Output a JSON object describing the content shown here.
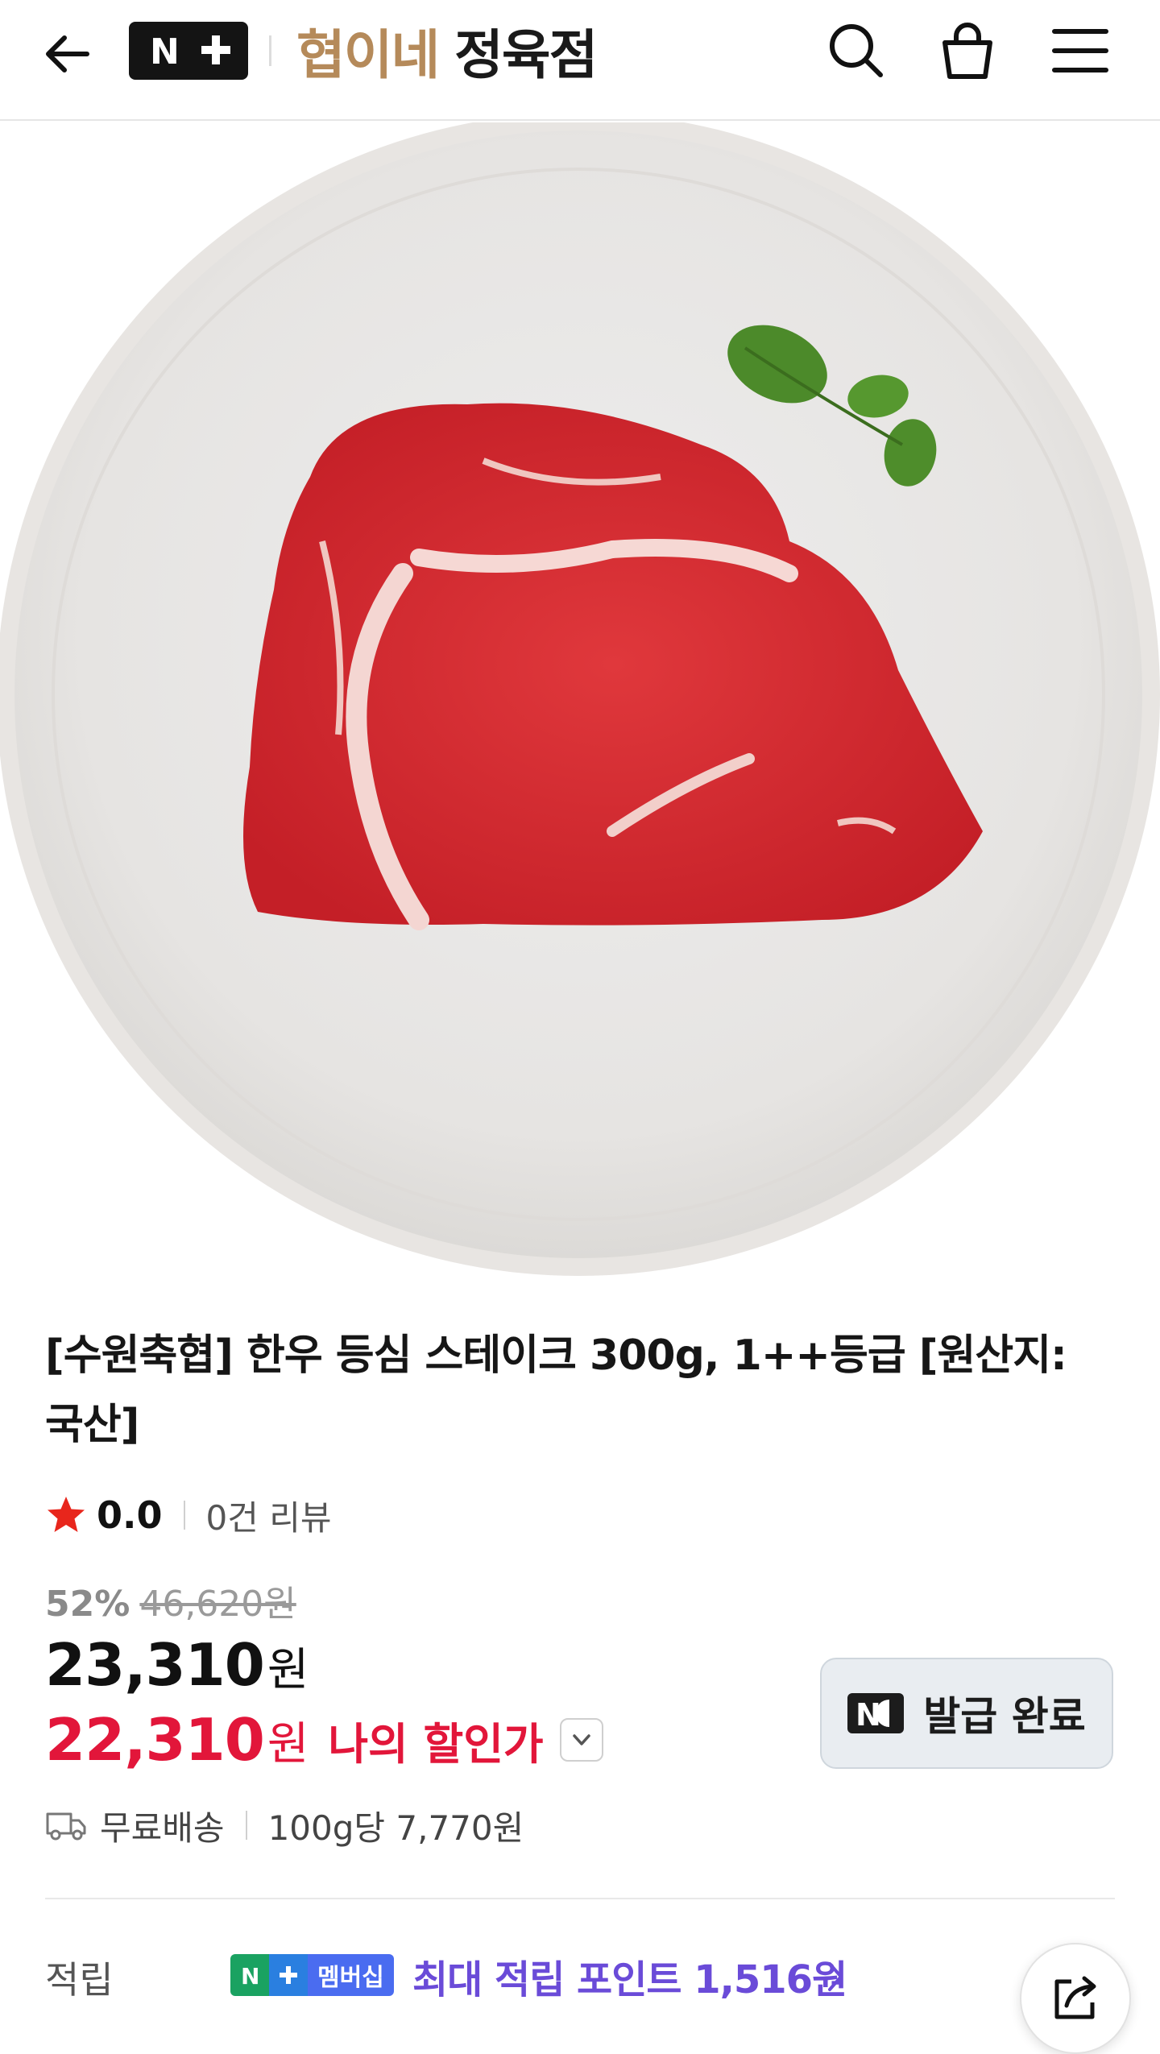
{
  "header": {
    "logo_text": "N+",
    "store_name_part1": "협이네",
    "store_name_part2": "정육점",
    "icons": [
      "back-arrow-icon",
      "search-icon",
      "shopping-bag-icon",
      "menu-icon"
    ]
  },
  "product": {
    "title": "[수원축협] 한우 등심 스테이크 300g, 1++등급 [원산지: 국산]",
    "image_description_icon": "steak-plate-image",
    "rating": "0.0",
    "review_count": "0건 리뷰",
    "discount_percent": "52%",
    "original_price": "46,620원",
    "price_amount": "23,310",
    "price_unit": "원",
    "my_price_amount": "22,310",
    "my_price_unit": "원",
    "my_price_label": "나의 할인가",
    "coupon_button_label": "발급 완료",
    "delivery": "무료배송",
    "unit_price": "100g당 7,770원"
  },
  "points": {
    "label": "적립",
    "badge_text": "멤버십",
    "text": "최대 적립 포인트 1,516원"
  },
  "colors": {
    "accent_red": "#e2163a",
    "brand_gold": "#b58a5a",
    "points_purple": "#6a4bd8",
    "star_red": "#e8261c"
  }
}
